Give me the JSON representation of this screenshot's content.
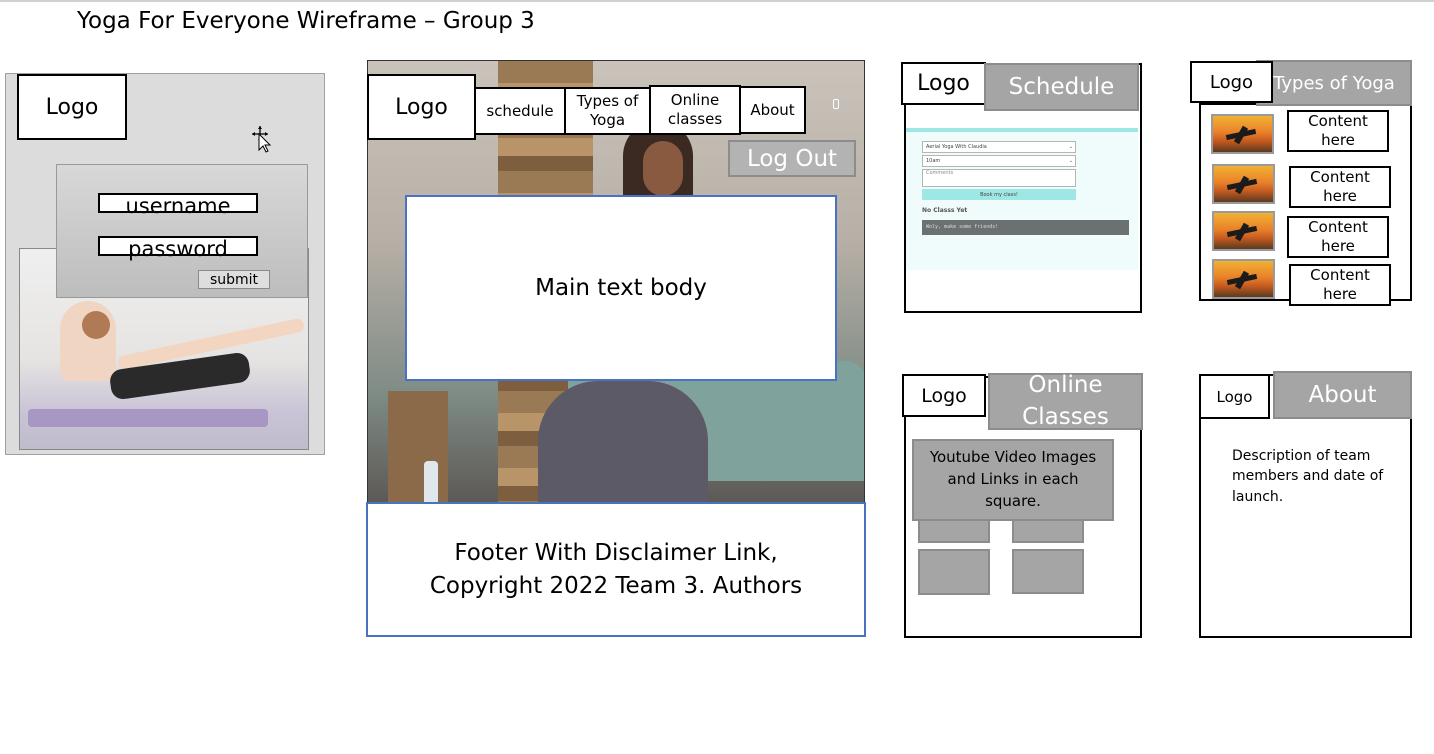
{
  "title": "Yoga For Everyone Wireframe – Group 3",
  "login": {
    "logo": "Logo",
    "username": "username",
    "password": "password",
    "submit": "submit"
  },
  "home": {
    "logo": "Logo",
    "nav": [
      "schedule",
      "Types of\nYoga",
      "Online\nclasses",
      "About"
    ],
    "logout": "Log Out",
    "main_text": "Main text body",
    "footer": "Footer With Disclaimer Link, Copyright 2022 Team 3. Authors"
  },
  "schedule": {
    "logo": "Logo",
    "heading": "Schedule",
    "select_class": "Aerial Yoga With Claudia",
    "select_time": "10am",
    "comments_placeholder": "Comments",
    "book_button": "Book my class!",
    "no_classes": "No Classs Yet",
    "message": "Woly, make some friends!"
  },
  "types": {
    "logo": "Logo",
    "heading": "Types of Yoga",
    "items": [
      "Content\nhere",
      "Content\nhere",
      "Content\nhere",
      "Content\nhere"
    ]
  },
  "online": {
    "logo": "Logo",
    "heading": "Online\nClasses",
    "text": "Youtube Video Images and Links in each square."
  },
  "about": {
    "logo": "Logo",
    "heading": "About",
    "description": "Description of team members and date of launch."
  },
  "icons": [
    "cursor-move-icon",
    "page-marker-icon",
    "chevron-down-icon"
  ]
}
